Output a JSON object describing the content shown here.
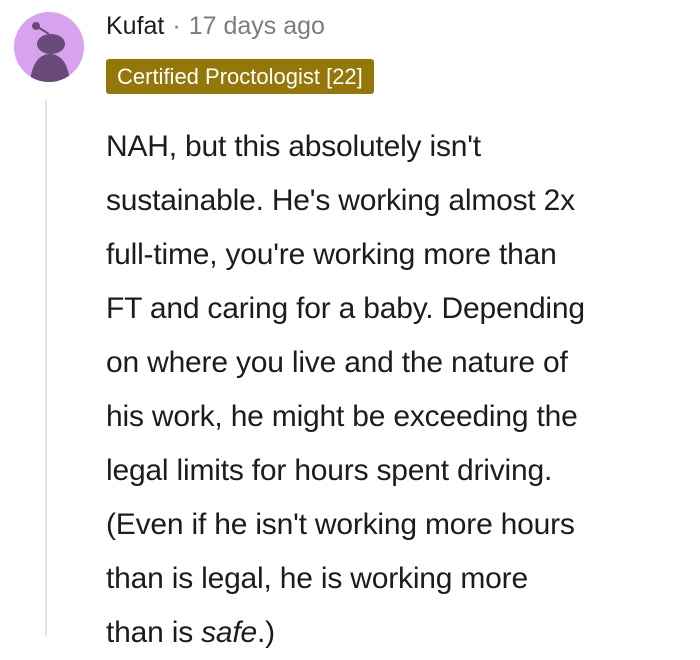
{
  "comment": {
    "author": "Kufat",
    "separator": "·",
    "time": "17 days ago",
    "flair": "Certified Proctologist [22]",
    "avatar_icon": "snoo-avatar-icon",
    "colors": {
      "avatar_bg": "#d9a2f0",
      "avatar_figure": "#6a4a7a",
      "flair_bg": "#937709",
      "flair_text": "#ffffff",
      "thread_line": "#e4e6e8",
      "meta_text": "#7c7c7c"
    },
    "body": {
      "lines": [
        "NAH, but this absolutely isn't",
        "sustainable. He's working almost 2x",
        "full-time, you're working more than",
        "FT and caring for a baby. Depending",
        "on where you live and the nature of",
        "his work, he might be exceeding the",
        "legal limits for hours spent driving.",
        "(Even if he isn't working more hours",
        "than is legal, he is working more"
      ],
      "last_line_before": "than is ",
      "last_line_emphasis": "safe",
      "last_line_after": ".)"
    }
  }
}
